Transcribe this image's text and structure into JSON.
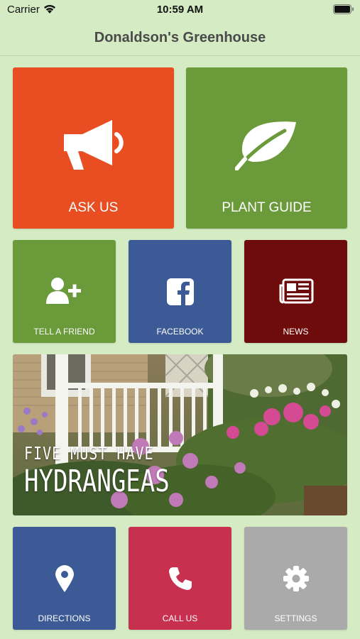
{
  "status_bar": {
    "carrier": "Carrier",
    "time": "10:59 AM"
  },
  "header": {
    "title": "Donaldson's Greenhouse"
  },
  "tiles": {
    "ask_us": {
      "label": "ASK US",
      "icon": "megaphone-icon",
      "color": "#e84e22"
    },
    "plant_guide": {
      "label": "PLANT GUIDE",
      "icon": "leaf-icon",
      "color": "#6a9a3a"
    },
    "tell_a_friend": {
      "label": "TELL A FRIEND",
      "icon": "add-user-icon",
      "color": "#6a9a3a"
    },
    "facebook": {
      "label": "FACEBOOK",
      "icon": "facebook-icon",
      "color": "#3c5a96"
    },
    "news": {
      "label": "NEWS",
      "icon": "newspaper-icon",
      "color": "#6e0b0b"
    },
    "directions": {
      "label": "DIRECTIONS",
      "icon": "map-pin-icon",
      "color": "#3c5a96"
    },
    "call_us": {
      "label": "CALL US",
      "icon": "phone-icon",
      "color": "#c8304f"
    },
    "settings": {
      "label": "SETTINGS",
      "icon": "gear-icon",
      "color": "#aaaaaa"
    }
  },
  "banner": {
    "line1": "FIVE MUST HAVE",
    "line2": "HYDRANGEAS"
  }
}
